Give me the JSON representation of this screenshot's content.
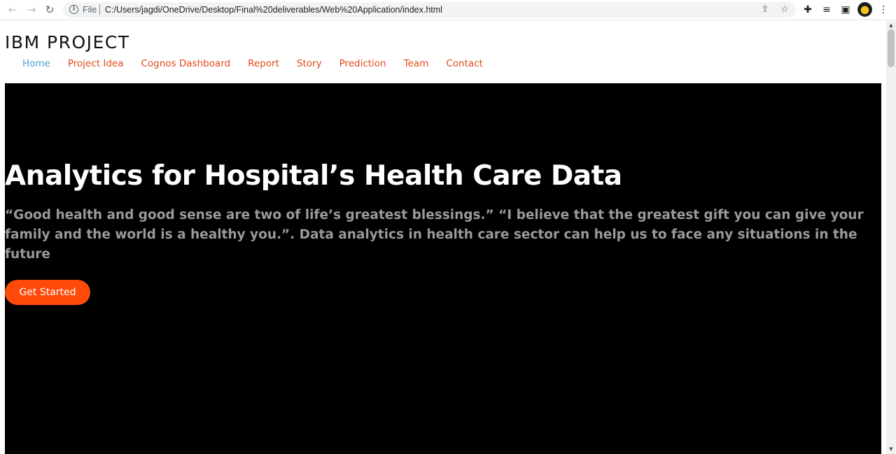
{
  "browser": {
    "scheme_label": "File",
    "url": "C:/Users/jagdi/OneDrive/Desktop/Final%20deliverables/Web%20Application/index.html",
    "icons": [
      "back-arrow-icon",
      "forward-arrow-icon",
      "reload-icon",
      "info-icon",
      "share-icon",
      "star-icon",
      "extensions-icon",
      "reading-list-icon",
      "side-panel-icon",
      "profile-avatar",
      "kebab-menu-icon"
    ]
  },
  "site": {
    "brand": "IBM PROJECT",
    "nav": [
      {
        "label": "Home",
        "active": true
      },
      {
        "label": "Project Idea",
        "active": false
      },
      {
        "label": "Cognos Dashboard",
        "active": false
      },
      {
        "label": "Report",
        "active": false
      },
      {
        "label": "Story",
        "active": false
      },
      {
        "label": "Prediction",
        "active": false
      },
      {
        "label": "Team",
        "active": false
      },
      {
        "label": "Contact",
        "active": false
      }
    ]
  },
  "hero": {
    "title": "Analytics for Hospital’s Health Care Data",
    "subtitle": "“Good health and good sense are two of life’s greatest blessings.” “I believe that the greatest gift you can give your family and the world is a healthy you.”. Data analytics in health care sector can help us to face any situations in the future",
    "cta_label": "Get Started"
  },
  "colors": {
    "accent": "#ff4a0a",
    "nav_link": "#e04a1a",
    "nav_active": "#4b9fd6",
    "hero_bg": "#000000"
  }
}
